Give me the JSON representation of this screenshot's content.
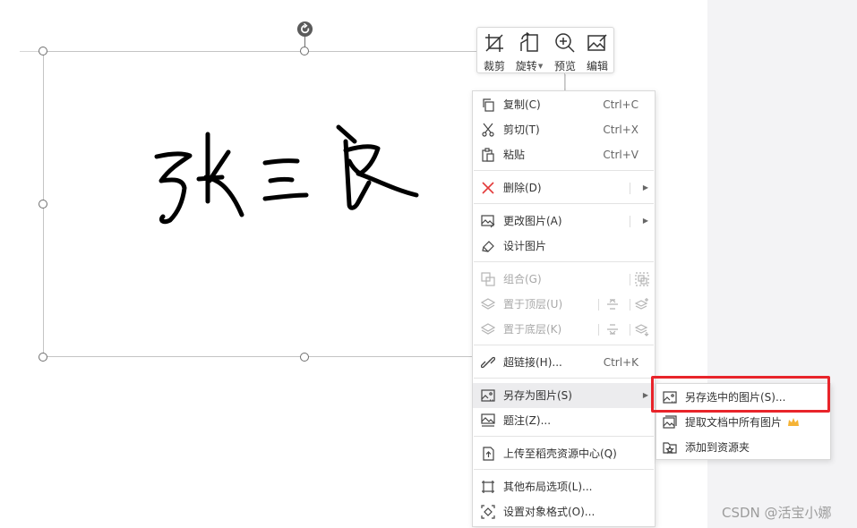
{
  "toolbar": {
    "items": [
      {
        "label": "裁剪",
        "icon": "crop-icon"
      },
      {
        "label": "旋转",
        "icon": "rotate-icon"
      },
      {
        "label": "预览",
        "icon": "zoom-icon"
      },
      {
        "label": "编辑",
        "icon": "edit-image-icon"
      }
    ]
  },
  "signature": {
    "text": "张三良"
  },
  "menu": {
    "items": [
      {
        "label": "复制(C)",
        "shortcut": "Ctrl+C"
      },
      {
        "label": "剪切(T)",
        "shortcut": "Ctrl+X"
      },
      {
        "label": "粘贴",
        "shortcut": "Ctrl+V"
      },
      {
        "label": "删除(D)"
      },
      {
        "label": "更改图片(A)"
      },
      {
        "label": "设计图片"
      },
      {
        "label": "组合(G)"
      },
      {
        "label": "置于顶层(U)"
      },
      {
        "label": "置于底层(K)"
      },
      {
        "label": "超链接(H)...",
        "shortcut": "Ctrl+K"
      },
      {
        "label": "另存为图片(S)"
      },
      {
        "label": "题注(Z)..."
      },
      {
        "label": "上传至稻壳资源中心(Q)"
      },
      {
        "label": "其他布局选项(L)..."
      },
      {
        "label": "设置对象格式(O)..."
      }
    ]
  },
  "submenu": {
    "items": [
      {
        "label": "另存选中的图片(S)..."
      },
      {
        "label": "提取文档中所有图片"
      },
      {
        "label": "添加到资源夹"
      }
    ]
  },
  "colors": {
    "highlight": "#e8242a",
    "disabled_text": "#a8a8a8",
    "hover_bg": "#ececee",
    "crown": "#f5b335"
  },
  "watermark": "CSDN @活宝小娜"
}
